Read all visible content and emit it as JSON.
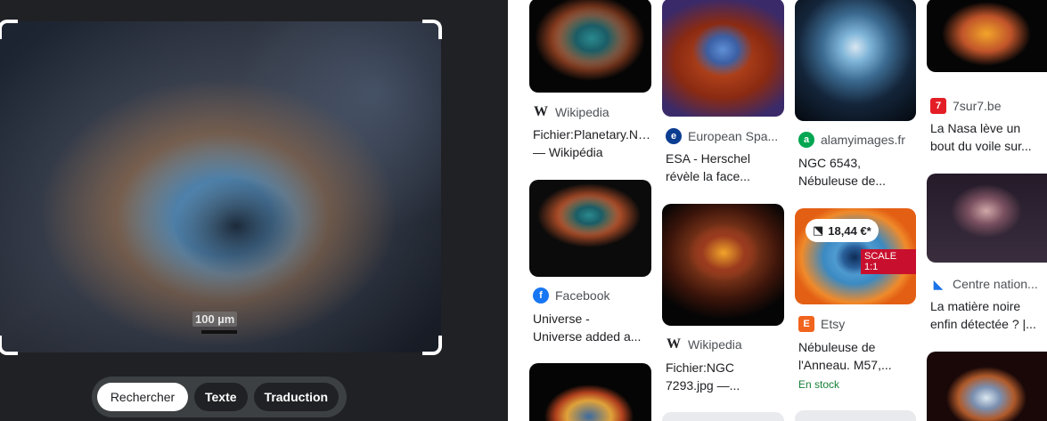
{
  "query": {
    "scale_label": "100 µm"
  },
  "modes": [
    {
      "label": "Rechercher",
      "active": true
    },
    {
      "label": "Texte",
      "active": false
    },
    {
      "label": "Traduction",
      "active": false
    }
  ],
  "results": [
    {
      "source": "Wikipedia",
      "source_icon": "wikipedia-icon",
      "title_lines": [
        "Fichier:Planetary.Neb",
        "— Wikipédia"
      ]
    },
    {
      "source": "European Spa...",
      "source_icon": "esa-icon",
      "icon_color": "#0b3d91",
      "title_lines": [
        "ESA - Herschel",
        "révèle la face..."
      ]
    },
    {
      "source": "alamyimages.fr",
      "source_icon": "alamy-icon",
      "icon_color": "#00a651",
      "title_lines": [
        "NGC 6543,",
        "Nébuleuse de..."
      ]
    },
    {
      "source": "7sur7.be",
      "source_icon": "7sur7-icon",
      "icon_color": "#e41e26",
      "title_lines": [
        "La Nasa lève un",
        "bout du voile sur..."
      ]
    },
    {
      "source": "Facebook",
      "source_icon": "facebook-icon",
      "icon_color": "#1877f2",
      "title_lines": [
        "Universe -",
        "Universe added a..."
      ]
    },
    {
      "source": "Wikipedia",
      "source_icon": "wikipedia-icon",
      "title_lines": [
        "Fichier:NGC",
        "7293.jpg —..."
      ]
    },
    {
      "source": "Etsy",
      "source_icon": "etsy-icon",
      "icon_color": "#f1641e",
      "title_lines": [
        "Nébuleuse de",
        "l'Anneau. M57,..."
      ],
      "price": "18,44 €*",
      "badge": "SCALE 1:1",
      "stock": "En stock"
    },
    {
      "source": "Centre nation...",
      "source_icon": "cnrs-icon",
      "icon_color": "#1a73e8",
      "title_lines": [
        "La matière noire",
        "enfin détectée ? |..."
      ]
    }
  ]
}
